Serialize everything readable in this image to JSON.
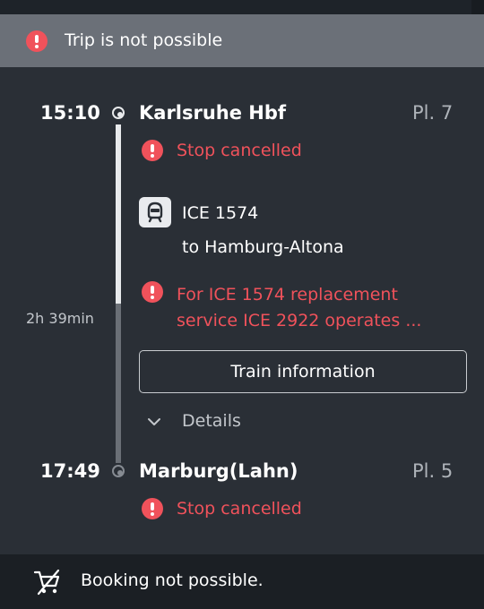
{
  "alert_bar": {
    "icon": "exclamation-circle-icon",
    "text": "Trip is not possible"
  },
  "departure": {
    "time": "15:10",
    "station": "Karlsruhe Hbf",
    "platform": "Pl. 7",
    "status": "Stop cancelled"
  },
  "train": {
    "icon": "train-icon",
    "name": "ICE 1574",
    "destination": "to Hamburg-Altona",
    "notice": "For ICE 1574 replacement service ICE 2922 operates ..."
  },
  "duration": "2h 39min",
  "train_info_button": "Train information",
  "details_toggle": {
    "icon": "chevron-down-icon",
    "label": "Details"
  },
  "arrival": {
    "time": "17:49",
    "station": "Marburg(Lahn)",
    "platform": "Pl. 5",
    "status": "Stop cancelled"
  },
  "booking_bar": {
    "icon": "cart-crossed-icon",
    "text": "Booking not possible."
  },
  "colors": {
    "alert_red": "#f0525b",
    "background": "#2a2f36",
    "alert_bar": "#6b7078",
    "booking_bar": "#1b1f24"
  }
}
